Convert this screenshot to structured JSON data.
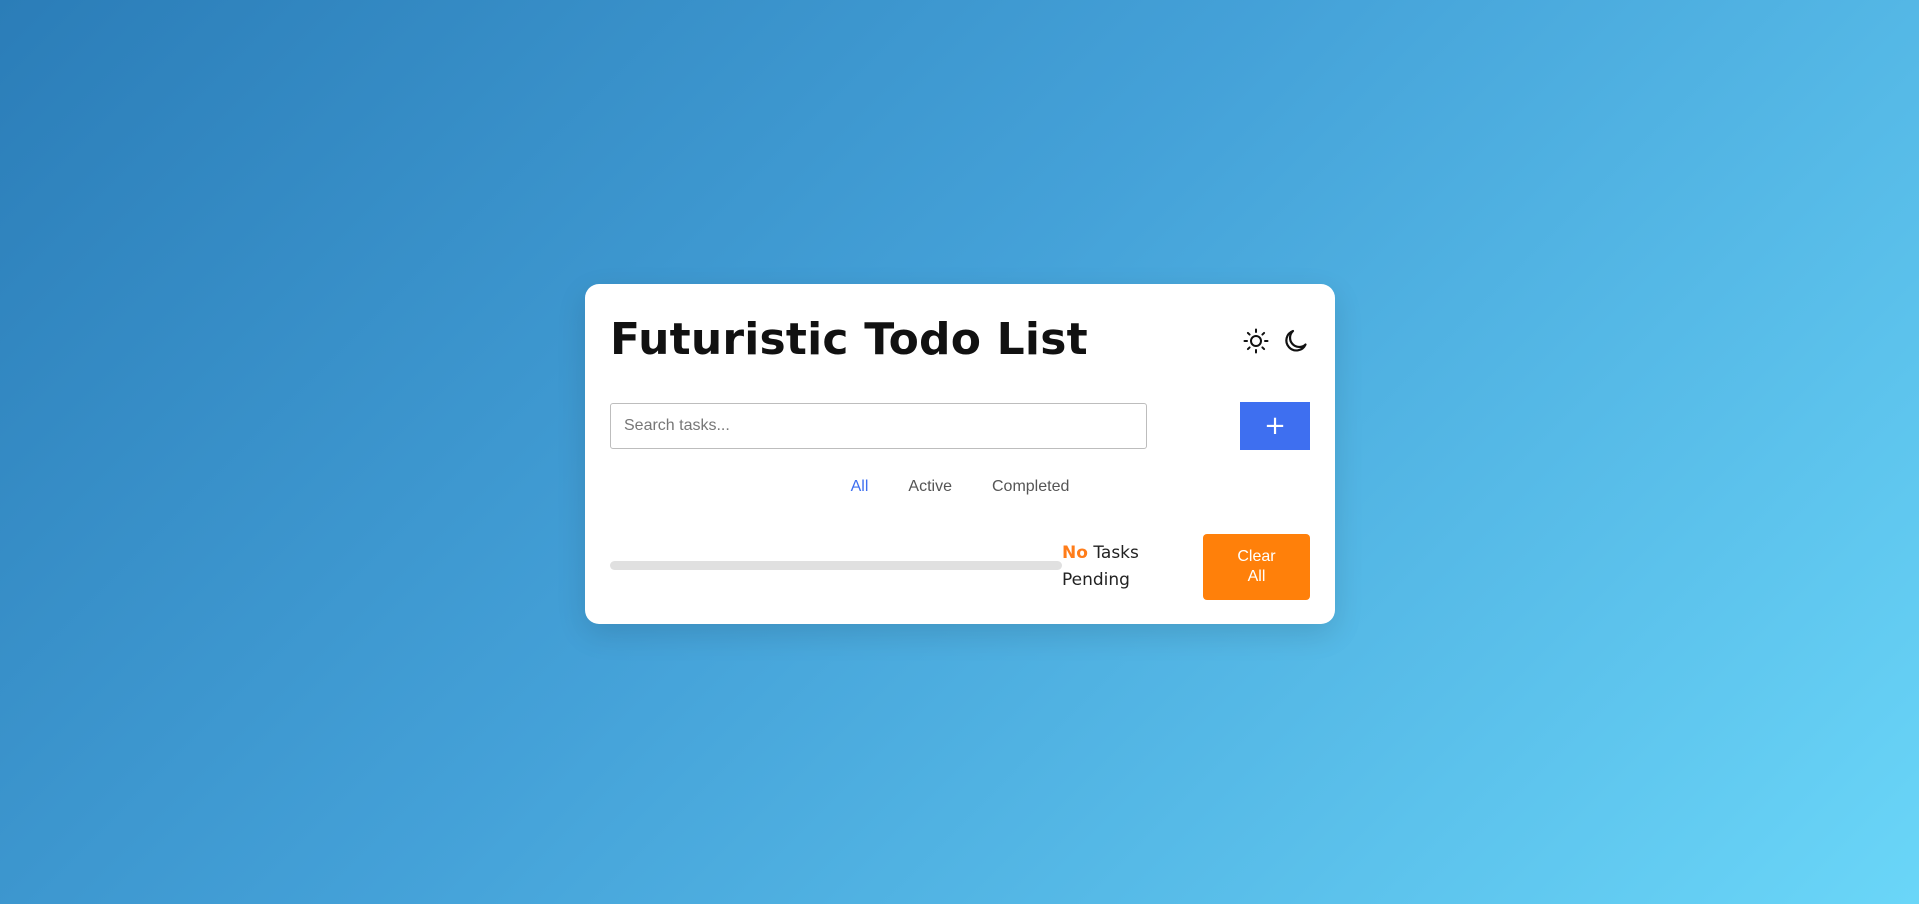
{
  "app": {
    "title": "Futuristic Todo List"
  },
  "theme": {
    "light_icon": "sun-icon",
    "dark_icon": "moon-icon"
  },
  "search": {
    "placeholder": "Search tasks...",
    "value": ""
  },
  "add_button": {
    "label": "+"
  },
  "filters": {
    "items": [
      "All",
      "Active",
      "Completed"
    ],
    "active": "All"
  },
  "progress": {
    "completed_fraction": 0
  },
  "status": {
    "count": "No",
    "text": "Tasks Pending"
  },
  "clear_button": {
    "label": "Clear All"
  },
  "colors": {
    "accent_blue": "#3e6ff0",
    "accent_orange": "#ff800a",
    "background_start": "#2b7db8",
    "background_end": "#6ad6f8"
  }
}
